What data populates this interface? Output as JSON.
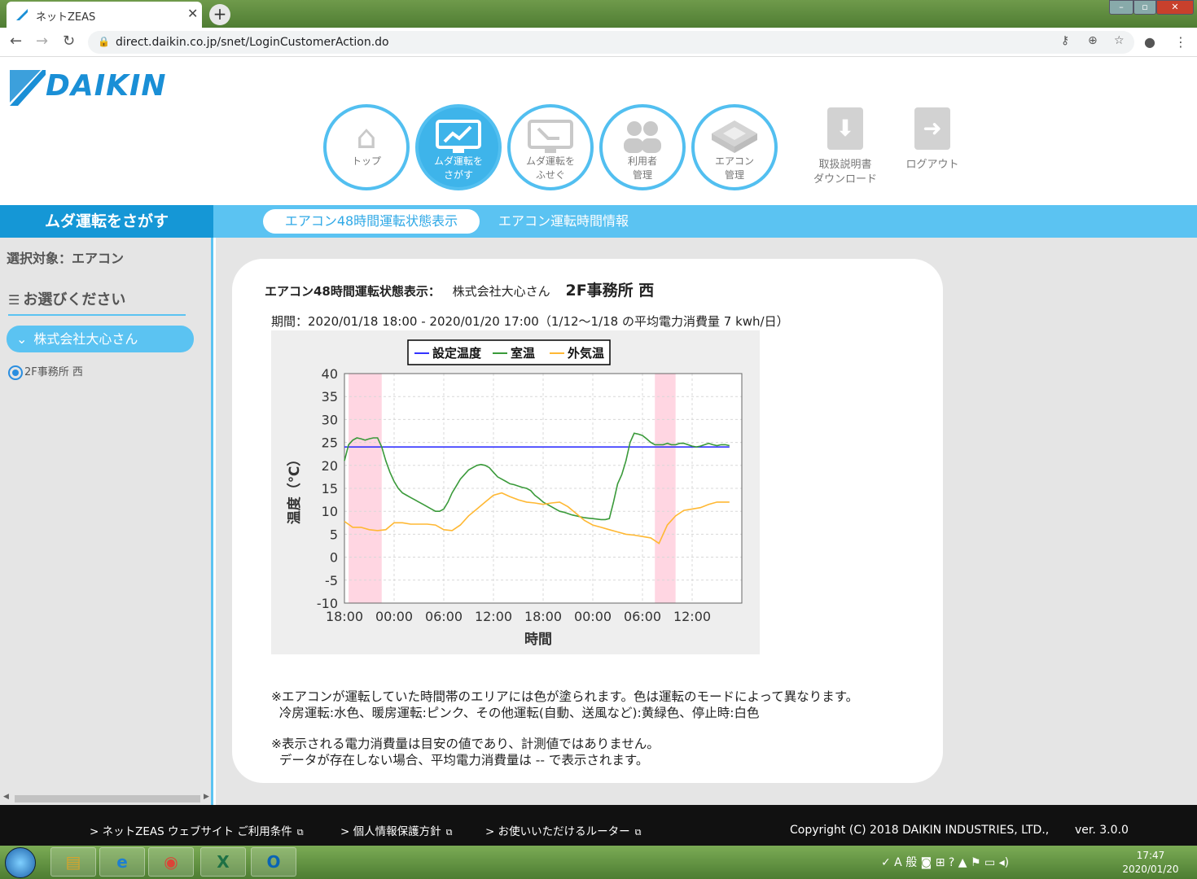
{
  "browser": {
    "tab_title": "ネットZEAS",
    "tab_close": "✕",
    "new_tab": "+",
    "url": "direct.daikin.co.jp/snet/LoginCustomerAction.do"
  },
  "header": {
    "logo_text": "DAIKIN",
    "nav": [
      {
        "label": "トップ",
        "icon": "home-icon"
      },
      {
        "label": "ムダ運転を\nさがす",
        "icon": "chart-monitor-icon",
        "active": true
      },
      {
        "label": "ムダ運転を\nふせぐ",
        "icon": "monitor-arrow-icon"
      },
      {
        "label": "利用者\n管理",
        "icon": "users-icon"
      },
      {
        "label": "エアコン\n管理",
        "icon": "aircon-icon"
      }
    ],
    "download_label": "取扱説明書\nダウンロード",
    "logout_label": "ログアウト"
  },
  "bluebar": {
    "section_title": "ムダ運転をさがす",
    "tab_active": "エアコン48時間運転状態表示",
    "tab_other": "エアコン運転時間情報"
  },
  "sidebar": {
    "target_label": "選択対象：エアコン",
    "choose_label": "お選びください",
    "company": "株式会社大心さん",
    "office": "2F事務所 西"
  },
  "main": {
    "title_prefix": "エアコン48時間運転状態表示：",
    "customer": "株式会社大心さん",
    "place": "2F事務所 西",
    "period": "期間：2020/01/18 18:00 - 2020/01/20 17:00（1/12～1/18 の平均電力消費量 7 kwh/日）",
    "note1": "※エアコンが運転していた時間帯のエリアには色が塗られます。色は運転のモードによって異なります。\n  冷房運転:水色、暖房運転:ピンク、その他運転(自動、送風など):黄緑色、停止時:白色",
    "note2": "※表示される電力消費量は目安の値であり、計測値ではありません。\n  データが存在しない場合、平均電力消費量は -- で表示されます。"
  },
  "chart_data": {
    "type": "line",
    "xlabel": "時間",
    "ylabel": "温度（℃）",
    "ylim": [
      -10,
      40
    ],
    "yticks": [
      40,
      35,
      30,
      25,
      20,
      15,
      10,
      5,
      0,
      -5,
      -10
    ],
    "xticks": [
      "18:00",
      "00:00",
      "06:00",
      "12:00",
      "18:00",
      "00:00",
      "06:00",
      "12:00"
    ],
    "xtick_hours": [
      0,
      6,
      12,
      18,
      24,
      30,
      36,
      42
    ],
    "xlim_hours": [
      0,
      48
    ],
    "grid": true,
    "legend_position": "top",
    "series": [
      {
        "name": "設定温度",
        "color": "#3333ff",
        "x": [
          0,
          46.5
        ],
        "values": [
          24,
          24
        ]
      },
      {
        "name": "室温",
        "color": "#3a9a3a",
        "x": [
          0,
          0.5,
          1,
          1.5,
          2,
          2.5,
          3,
          3.5,
          4,
          4.5,
          5,
          5.5,
          6,
          6.5,
          7,
          7.5,
          8,
          8.5,
          9,
          9.5,
          10,
          10.5,
          11,
          11.5,
          12,
          12.5,
          13,
          13.5,
          14,
          14.5,
          15,
          15.5,
          16,
          16.5,
          17,
          17.5,
          18,
          18.5,
          19,
          19.5,
          20,
          20.5,
          21,
          21.5,
          22,
          22.5,
          23,
          23.5,
          24,
          24.5,
          25,
          25.5,
          26,
          26.5,
          27,
          27.5,
          28,
          28.5,
          29,
          29.5,
          30,
          30.5,
          31,
          31.5,
          32,
          32.5,
          33,
          33.5,
          34,
          34.5,
          35,
          35.5,
          36,
          36.5,
          37,
          37.5,
          38,
          38.5,
          39,
          39.5,
          40,
          40.5,
          41,
          41.5,
          42,
          42.5,
          43,
          43.5,
          44,
          44.5,
          45,
          45.5,
          46,
          46.5
        ],
        "values": [
          21,
          24.5,
          25.5,
          26,
          25.8,
          25.5,
          25.8,
          26,
          26,
          24,
          21,
          18.5,
          16.5,
          15,
          14,
          13.5,
          13,
          12.5,
          12,
          11.5,
          11,
          10.5,
          10,
          10,
          10.5,
          12,
          14,
          15.5,
          17,
          18,
          19,
          19.5,
          20,
          20.2,
          20,
          19.5,
          18.5,
          17.5,
          17,
          16.5,
          16,
          15.8,
          15.5,
          15.2,
          15,
          14.5,
          13.5,
          12.8,
          12,
          11.5,
          11,
          10.5,
          10,
          9.8,
          9.5,
          9.2,
          9,
          8.8,
          8.6,
          8.5,
          8.4,
          8.3,
          8.2,
          8.2,
          8.4,
          12,
          16,
          18,
          21,
          25,
          27,
          26.8,
          26.5,
          25.8,
          25,
          24.5,
          24.5,
          24.5,
          24.8,
          24.5,
          24.5,
          24.8,
          24.8,
          24.5,
          24.2,
          24,
          24.2,
          24.5,
          24.8,
          24.5,
          24.3,
          24.5,
          24.5,
          24.3
        ]
      },
      {
        "name": "外気温",
        "color": "#ffb833",
        "x": [
          0,
          1,
          2,
          3,
          4,
          5,
          6,
          7,
          8,
          9,
          10,
          11,
          12,
          13,
          14,
          15,
          16,
          17,
          18,
          19,
          20,
          21,
          22,
          23,
          24,
          25,
          26,
          27,
          28,
          29,
          30,
          31,
          32,
          33,
          34,
          35,
          36,
          37,
          38,
          39,
          40,
          41,
          42,
          43,
          44,
          45,
          46,
          46.5
        ],
        "values": [
          7.8,
          6.5,
          6.5,
          6,
          5.8,
          6,
          7.5,
          7.5,
          7.2,
          7.2,
          7.2,
          7,
          6,
          5.8,
          7,
          9,
          10.5,
          12,
          13.5,
          14,
          13.2,
          12.5,
          12,
          11.8,
          11.5,
          11.8,
          12,
          11,
          9.5,
          8,
          7,
          6.5,
          6,
          5.5,
          5,
          4.8,
          4.5,
          4.2,
          3,
          7,
          9,
          10.2,
          10.5,
          10.8,
          11.5,
          12,
          12,
          12
        ]
      }
    ],
    "shaded_ranges_hours": [
      [
        0.5,
        4.5
      ],
      [
        37.5,
        40
      ]
    ],
    "shaded_color": "#ffd6e2"
  }
}
